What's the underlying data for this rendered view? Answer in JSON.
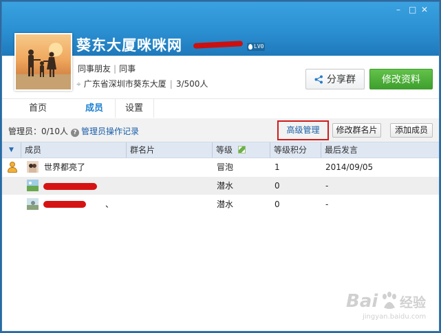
{
  "window": {
    "controls": [
      "–",
      "□",
      "✕"
    ]
  },
  "header": {
    "group_name": "葵东大厦咪咪网",
    "level_badge": "LV0",
    "tags": [
      "同事朋友",
      "同事"
    ],
    "location": "广东省深圳市葵东大厦",
    "members_count": "3/500人",
    "share_button": "分享群",
    "edit_button": "修改资料"
  },
  "tabs": [
    {
      "label": "首页",
      "active": false
    },
    {
      "label": "成员",
      "active": true
    },
    {
      "label": "设置",
      "active": false
    }
  ],
  "toolbar": {
    "admin_count": "管理员：0/10人",
    "admin_log_link": "管理员操作记录",
    "advanced_button": "高级管理",
    "edit_card_button": "修改群名片",
    "add_member_button": "添加成员"
  },
  "table": {
    "columns": [
      "成员",
      "群名片",
      "等级",
      "等级积分",
      "最后发言"
    ],
    "rows": [
      {
        "name": "世界都亮了",
        "card": "",
        "level": "冒泡",
        "points": "1",
        "last": "2014/09/05",
        "owner": true
      },
      {
        "name": "",
        "card": "",
        "level": "潜水",
        "points": "0",
        "last": "-",
        "owner": false
      },
      {
        "name": "、",
        "card": "",
        "level": "潜水",
        "points": "0",
        "last": "-",
        "owner": false
      }
    ]
  },
  "watermark": {
    "brand": "Bai",
    "suffix": "经验",
    "url": "jingyan.baidu.com"
  },
  "colors": {
    "header_blue": "#2a8fd1",
    "accent_green": "#4caf38",
    "link_blue": "#1b5fa8",
    "highlight_red": "#d11a1a"
  }
}
